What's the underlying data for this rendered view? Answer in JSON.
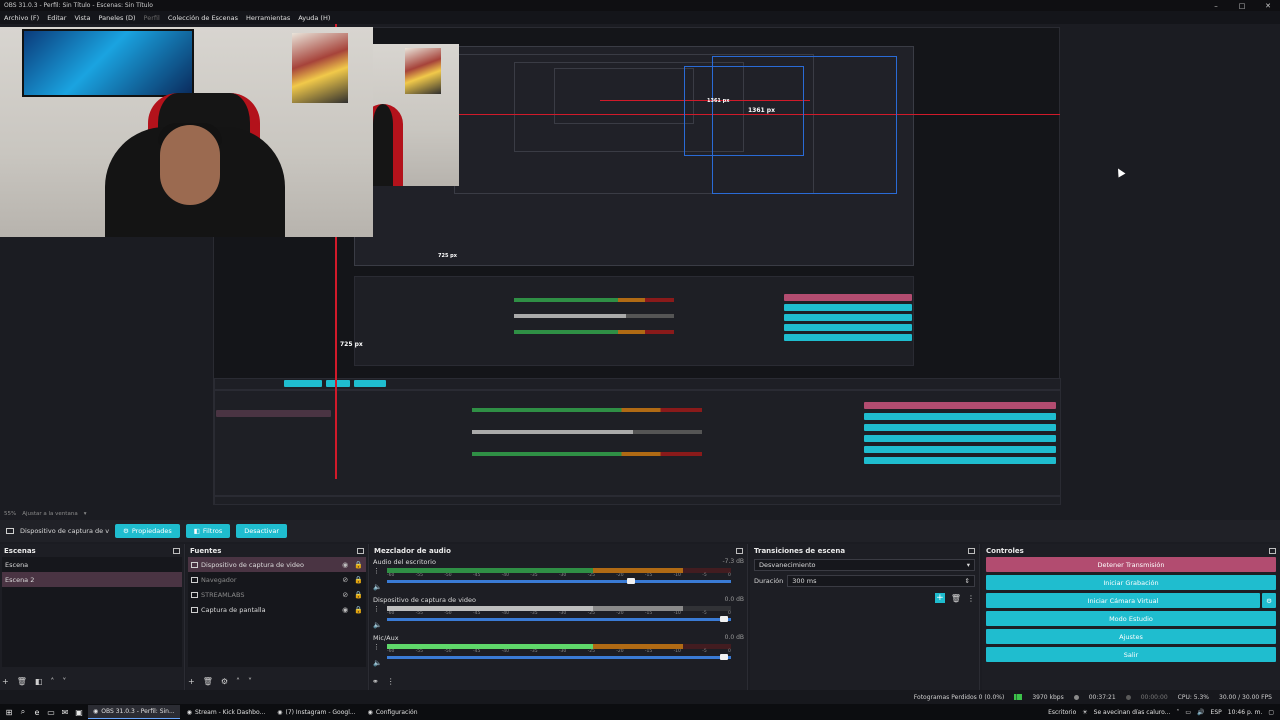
{
  "window": {
    "title": "OBS 31.0.3 - Perfil: Sin Título - Escenas: Sin Título"
  },
  "menu": [
    {
      "label": "Archivo (F)",
      "disabled": false
    },
    {
      "label": "Editar",
      "disabled": false
    },
    {
      "label": "Vista",
      "disabled": false
    },
    {
      "label": "Paneles (D)",
      "disabled": false
    },
    {
      "label": "Perfil",
      "disabled": true
    },
    {
      "label": "Colección de Escenas",
      "disabled": false
    },
    {
      "label": "Herramientas",
      "disabled": false
    },
    {
      "label": "Ayuda (H)",
      "disabled": false
    }
  ],
  "preview": {
    "measure_width": "1361 px",
    "measure_inner": "1361 px",
    "measure_height": "725 px",
    "measure_height_inner": "725 px",
    "zoom": "55%",
    "zoom_mode": "Ajustar a la ventana"
  },
  "source_toolbar": {
    "source_name": "Dispositivo de captura de v",
    "properties": "Propiedades",
    "filters": "Filtros",
    "deactivate": "Desactivar"
  },
  "scenes": {
    "title": "Escenas",
    "items": [
      "Escena",
      "Escena 2"
    ],
    "selected_index": 1
  },
  "sources": {
    "title": "Fuentes",
    "items": [
      {
        "name": "Dispositivo de captura de video",
        "dim": false,
        "selected": true,
        "visible": true
      },
      {
        "name": "Navegador",
        "dim": true,
        "selected": false,
        "visible": false
      },
      {
        "name": "STREAMLABS",
        "dim": true,
        "selected": false,
        "visible": false
      },
      {
        "name": "Captura de pantalla",
        "dim": false,
        "selected": false,
        "visible": true
      }
    ]
  },
  "mixer": {
    "title": "Mezclador de audio",
    "channels": [
      {
        "name": "Audio del escritorio",
        "db": "-7.3 dB",
        "level": 0.86,
        "style": "green",
        "volume": 0.72
      },
      {
        "name": "Dispositivo de captura de video",
        "db": "0.0 dB",
        "level": 0.84,
        "style": "gray",
        "volume": 0.99
      },
      {
        "name": "Mic/Aux",
        "db": "0.0 dB",
        "level": 0.64,
        "style": "light-green",
        "volume": 0.99
      }
    ],
    "ticks": [
      "-60",
      "-55",
      "-50",
      "-45",
      "-40",
      "-35",
      "-30",
      "-25",
      "-20",
      "-15",
      "-10",
      "-5",
      "0"
    ]
  },
  "transitions": {
    "title": "Transiciones de escena",
    "selected": "Desvanecimiento",
    "duration_label": "Duración",
    "duration_value": "300 ms"
  },
  "controls": {
    "title": "Controles",
    "buttons": [
      {
        "label": "Detener Transmisión",
        "style": "pink"
      },
      {
        "label": "Iniciar Grabación",
        "style": "teal"
      },
      {
        "label": "Iniciar Cámara Virtual",
        "style": "teal"
      },
      {
        "label": "Modo Estudio",
        "style": "teal"
      },
      {
        "label": "Ajustes",
        "style": "teal"
      },
      {
        "label": "Salir",
        "style": "teal"
      }
    ]
  },
  "status": {
    "dropped": "Fotogramas Perdidos 0 (0.0%)",
    "bitrate": "3970 kbps",
    "stream_time": "00:37:21",
    "rec_time": "00:00:00",
    "cpu": "CPU: 5.3%",
    "fps": "30.00 / 30.00 FPS"
  },
  "taskbar": {
    "apps": [
      {
        "label": "OBS 31.0.3 - Perfil: Sin...",
        "active": true
      },
      {
        "label": "Stream - Kick Dashbo...",
        "active": false
      },
      {
        "label": "(7) Instagram - Googl...",
        "active": false
      },
      {
        "label": "Configuración",
        "active": false
      }
    ],
    "desktop": "Escritorio",
    "notification": "Se avecinan días caluro...",
    "lang": "ESP",
    "clock": "10:46 p. m."
  },
  "colors": {
    "accent": "#1fbdcf",
    "live": "#b24c70",
    "selection": "#4a3443",
    "background": "#1b1c22"
  }
}
